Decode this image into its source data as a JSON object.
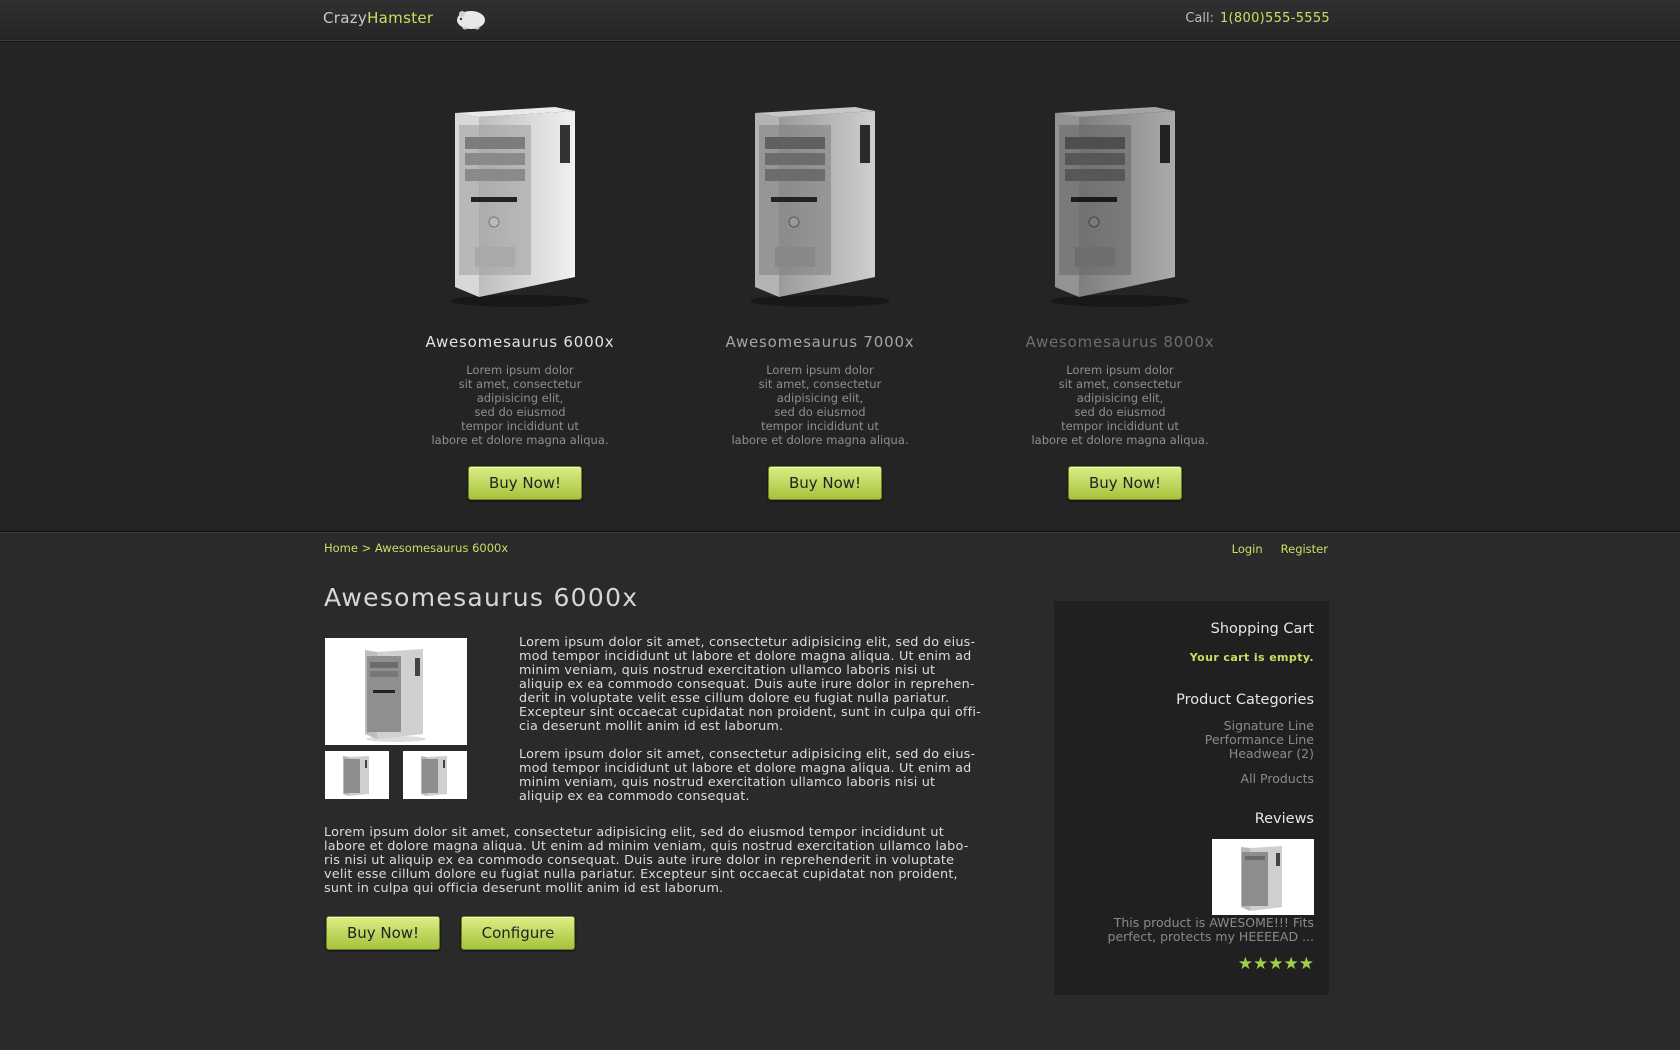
{
  "header": {
    "logo_part1": "Crazy",
    "logo_part2": "Hamster",
    "call_label": "Call:",
    "phone": "1(800)555-5555"
  },
  "featured": [
    {
      "name": "Awesomesaurus 6000x",
      "desc": [
        "Lorem ipsum dolor",
        "sit amet, consectetur",
        "adipisicing elit,",
        "sed do eiusmod",
        "tempor incididunt ut",
        "labore et dolore magna aliqua."
      ],
      "button": "Buy Now!"
    },
    {
      "name": "Awesomesaurus 7000x",
      "desc": [
        "Lorem ipsum dolor",
        "sit amet, consectetur",
        "adipisicing elit,",
        "sed do eiusmod",
        "tempor incididunt ut",
        "labore et dolore magna aliqua."
      ],
      "button": "Buy Now!"
    },
    {
      "name": "Awesomesaurus 8000x",
      "desc": [
        "Lorem ipsum dolor",
        "sit amet, consectetur",
        "adipisicing elit,",
        "sed do eiusmod",
        "tempor incididunt ut",
        "labore et dolore magna aliqua."
      ],
      "button": "Buy Now!"
    }
  ],
  "breadcrumb": "Home > Awesomesaurus 6000x",
  "auth": {
    "login": "Login",
    "register": "Register"
  },
  "product": {
    "title": "Awesomesaurus 6000x",
    "para1": [
      "Lorem ipsum dolor sit amet, consectetur adipisicing elit, sed do eius-",
      "mod tempor incididunt ut labore et dolore magna aliqua. Ut enim ad",
      "minim veniam, quis nostrud exercitation ullamco laboris nisi ut",
      "aliquip ex ea commodo consequat. Duis aute irure dolor in repreh­en-",
      "derit in voluptate velit esse cillum dolore eu fugiat nulla pariatur.",
      "Excepteur sint occaecat cupidatat non proident, sunt in culpa qui offi-",
      "cia deserunt mollit anim id est laborum."
    ],
    "para2": [
      "Lorem ipsum dolor sit amet, consectetur adipisicing elit, sed do eius-",
      "mod tempor incididunt ut labore et dolore magna aliqua. Ut enim ad",
      "minim veniam, quis nostrud exercitation ullamco laboris nisi ut",
      "aliquip ex ea commodo consequat."
    ],
    "para3": [
      "Lorem ipsum dolor sit amet, consectetur adipisicing elit, sed do eiusmod tempor incididunt ut",
      "labore et dolore magna aliqua. Ut enim ad minim veniam, quis nostrud exercitation ullamco labo-",
      "ris nisi ut aliquip ex ea commodo consequat. Duis aute irure dolor in reprehenderit in voluptate",
      "velit esse cillum dolore eu fugiat nulla pariatur. Excepteur sint occaecat cupidatat non proident,",
      "sunt in culpa qui officia deserunt mollit anim id est laborum."
    ],
    "buy_button": "Buy Now!",
    "configure_button": "Configure"
  },
  "sidebar": {
    "cart_title": "Shopping Cart",
    "cart_empty": "Your cart is empty.",
    "categories_title": "Product Categories",
    "categories": [
      "Signature Line",
      "Performance Line",
      "Headwear (2)"
    ],
    "all_products": "All Products",
    "reviews_title": "Reviews",
    "review_text": [
      "This product is AWESOME!!! Fits",
      "perfect, protects my HEEEEAD ..."
    ],
    "rating": 5,
    "stars": "★★★★★"
  },
  "colors": {
    "accent": "#c5e063",
    "background": "#2a2a2a",
    "button": "#b8d353"
  }
}
